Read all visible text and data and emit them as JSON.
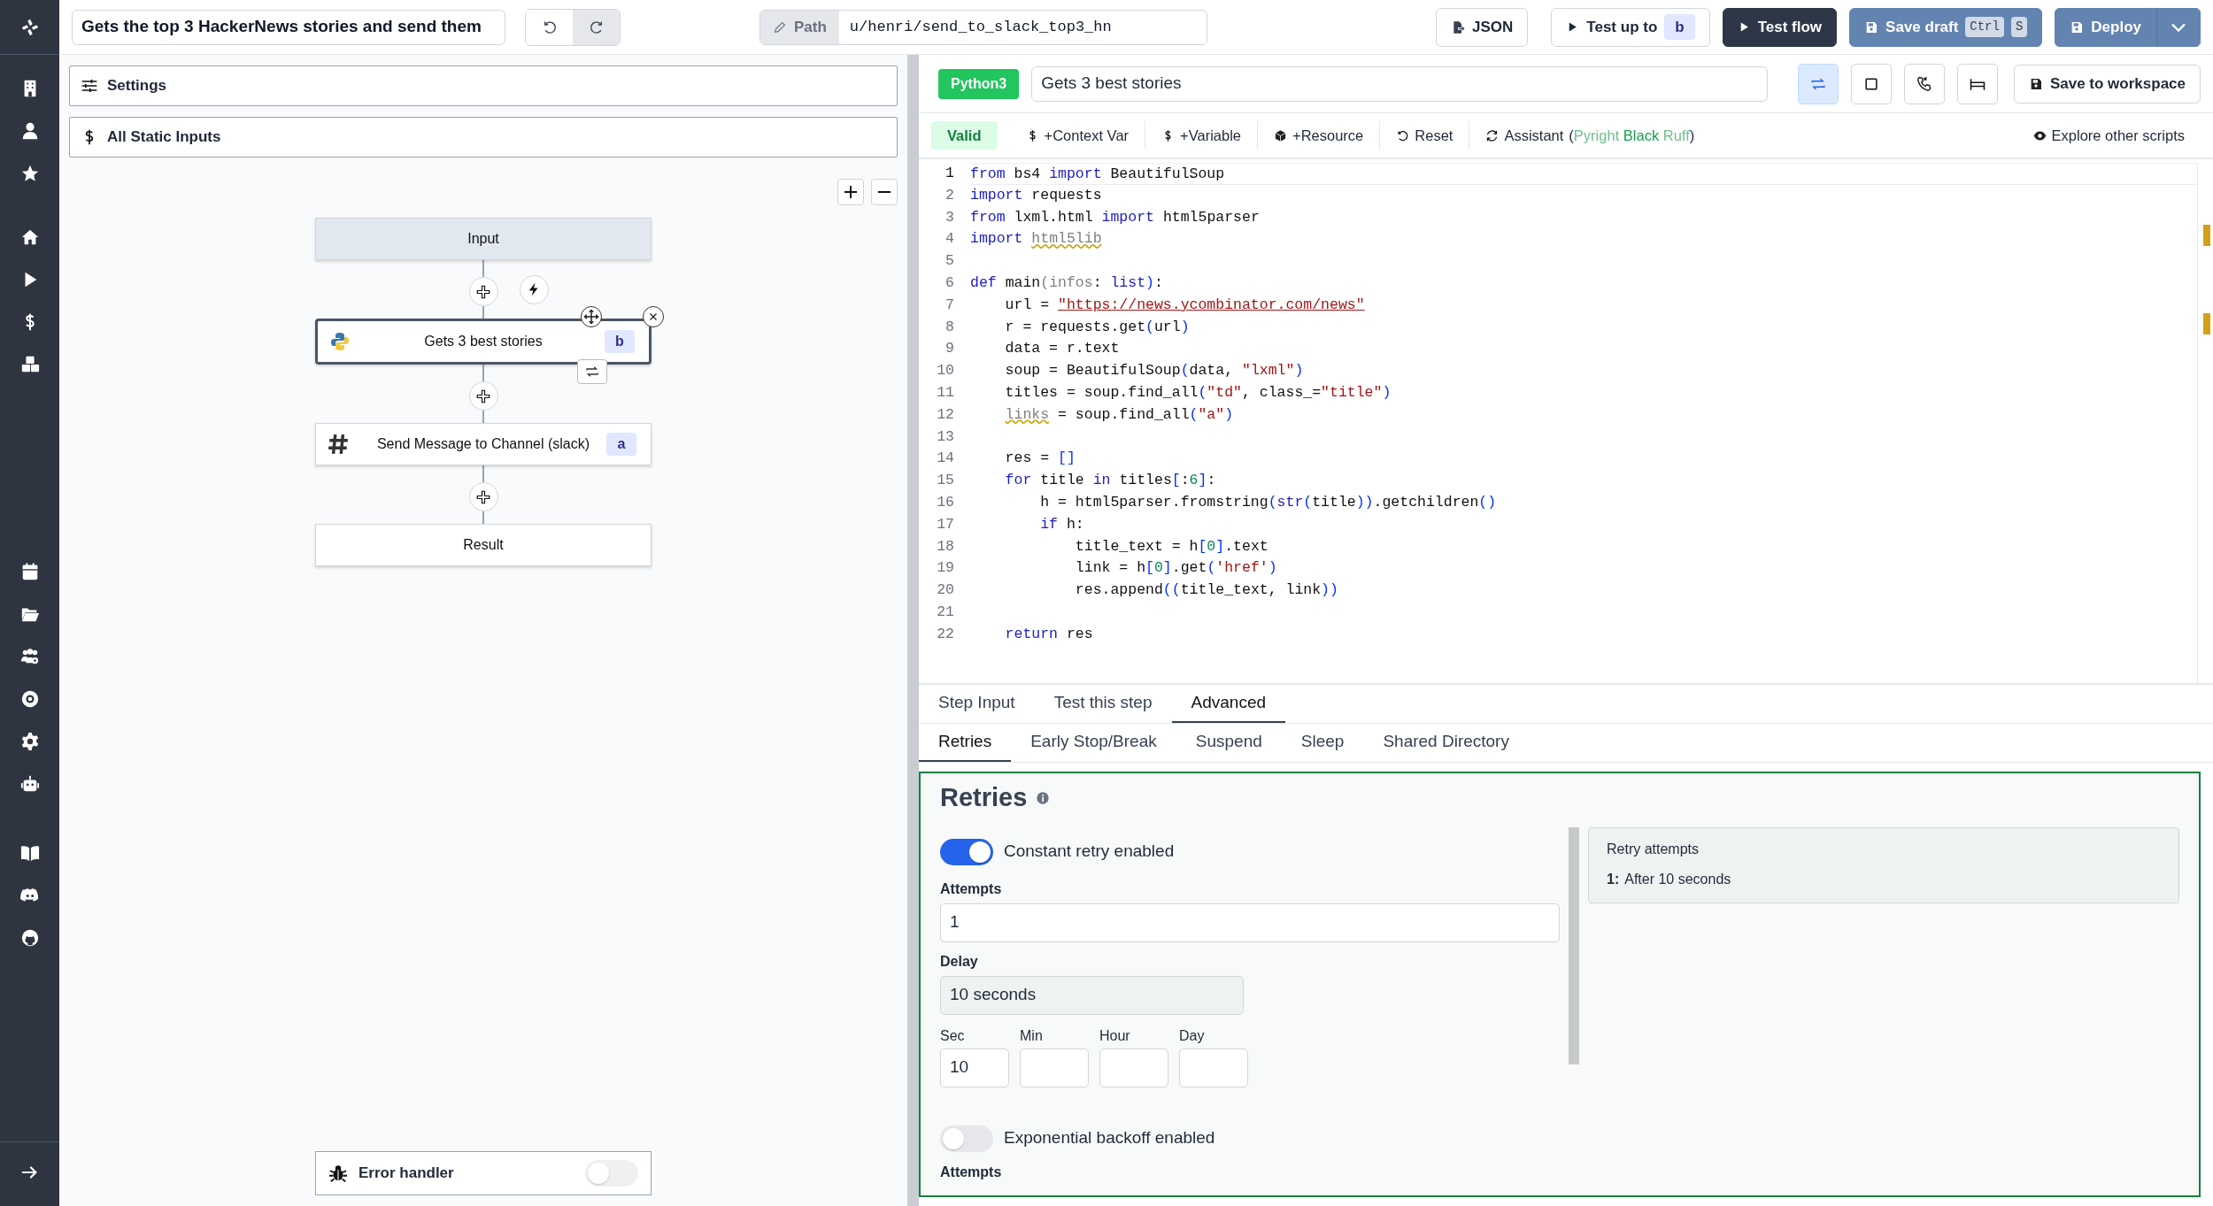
{
  "flow_title": "Gets the top 3 HackerNews stories and send them",
  "path": {
    "label": "Path",
    "value": "u/henri/send_to_slack_top3_hn"
  },
  "actions": [
    {
      "kind": "json",
      "label": "JSON"
    },
    {
      "kind": "test_up_to",
      "label": "Test up to",
      "badge": "b"
    },
    {
      "kind": "test_flow",
      "label": "Test flow"
    },
    {
      "kind": "save_draft",
      "label": "Save draft",
      "keys": [
        "Ctrl",
        "S"
      ]
    },
    {
      "kind": "deploy",
      "label": "Deploy"
    }
  ],
  "left_sections": [
    {
      "kind": "settings",
      "label": "Settings"
    },
    {
      "kind": "static",
      "label": "All Static Inputs"
    }
  ],
  "flow": {
    "nodes": [
      {
        "kind": "input",
        "label": "Input",
        "selected": false
      },
      {
        "kind": "script",
        "label": "Gets 3 best stories",
        "badge": "b",
        "selected": true
      },
      {
        "kind": "slack",
        "label": "Send Message to Channel (slack)",
        "badge": "a",
        "selected": false
      },
      {
        "kind": "result",
        "label": "Result",
        "selected": false
      }
    ]
  },
  "error_handler": {
    "label": "Error handler",
    "on": false
  },
  "script": {
    "language": "Python3",
    "summary": "Gets 3 best stories",
    "toggles": [
      {
        "kind": "loop",
        "on": true
      },
      {
        "kind": "square",
        "on": false
      },
      {
        "kind": "phone",
        "on": false
      },
      {
        "kind": "bed",
        "on": false
      }
    ],
    "save_label": "Save to workspace"
  },
  "editor_toolbar": [
    {
      "kind": "status",
      "label": "Valid"
    },
    {
      "kind": "context",
      "label": "+Context Var"
    },
    {
      "kind": "variable",
      "label": "+Variable"
    },
    {
      "kind": "resource",
      "label": "+Resource"
    },
    {
      "kind": "reset",
      "label": "Reset"
    },
    {
      "kind": "assistant",
      "label": "Assistant",
      "open": "(",
      "close": ")",
      "tools": [
        {
          "name": "Pyright",
          "active": false
        },
        {
          "name": "Black",
          "active": true
        },
        {
          "name": "Ruff",
          "active": false
        }
      ]
    }
  ],
  "explore_label": "Explore other scripts",
  "code": [
    {
      "number": "1",
      "tokens": [
        {
          "kind": "kw",
          "text": "from"
        },
        {
          "kind": "plain",
          "text": " bs4 "
        },
        {
          "kind": "kw",
          "text": "import"
        },
        {
          "kind": "plain",
          "text": " BeautifulSoup"
        }
      ]
    },
    {
      "number": "2",
      "tokens": [
        {
          "kind": "kw",
          "text": "import"
        },
        {
          "kind": "plain",
          "text": " requests"
        }
      ]
    },
    {
      "number": "3",
      "tokens": [
        {
          "kind": "kw",
          "text": "from"
        },
        {
          "kind": "plain",
          "text": " lxml.html "
        },
        {
          "kind": "kw",
          "text": "import"
        },
        {
          "kind": "plain",
          "text": " html5parser"
        }
      ]
    },
    {
      "number": "4",
      "tokens": [
        {
          "kind": "kw",
          "text": "import"
        },
        {
          "kind": "warn",
          "text": " html5lib"
        }
      ]
    },
    {
      "number": "5"
    },
    {
      "number": "6",
      "tokens": [
        {
          "kind": "kw",
          "text": "def"
        },
        {
          "kind": "plain",
          "text": " main"
        },
        {
          "kind": "param",
          "text": "(infos"
        },
        {
          "kind": "plain",
          "text": ": "
        },
        {
          "kind": "kw",
          "text": "list"
        },
        {
          "kind": "bracket",
          "text": ")"
        },
        {
          "kind": "plain",
          "text": ":"
        }
      ]
    },
    {
      "number": "7",
      "tokens": [
        {
          "kind": "plain",
          "text": "    url = "
        },
        {
          "kind": "link",
          "text": "\"https://news.ycombinator.com/news\""
        }
      ]
    },
    {
      "number": "8",
      "tokens": [
        {
          "kind": "plain",
          "text": "    r = requests.get"
        },
        {
          "kind": "bracket",
          "text": "("
        },
        {
          "kind": "plain",
          "text": "url"
        },
        {
          "kind": "bracket",
          "text": ")"
        }
      ]
    },
    {
      "number": "9",
      "tokens": [
        {
          "kind": "plain",
          "text": "    data = r.text"
        }
      ]
    },
    {
      "number": "10",
      "tokens": [
        {
          "kind": "plain",
          "text": "    soup = BeautifulSoup"
        },
        {
          "kind": "bracket",
          "text": "("
        },
        {
          "kind": "plain",
          "text": "data, "
        },
        {
          "kind": "str",
          "text": "\"lxml\""
        },
        {
          "kind": "bracket",
          "text": ")"
        }
      ]
    },
    {
      "number": "11",
      "tokens": [
        {
          "kind": "plain",
          "text": "    titles = soup.find_all"
        },
        {
          "kind": "bracket",
          "text": "("
        },
        {
          "kind": "str",
          "text": "\"td\""
        },
        {
          "kind": "plain",
          "text": ", class_="
        },
        {
          "kind": "str",
          "text": "\"title\""
        },
        {
          "kind": "bracket",
          "text": ")"
        }
      ]
    },
    {
      "number": "12",
      "tokens": [
        {
          "kind": "warn",
          "text": "    links"
        },
        {
          "kind": "plain",
          "text": " = soup.find_all"
        },
        {
          "kind": "bracket",
          "text": "("
        },
        {
          "kind": "str",
          "text": "\"a\""
        },
        {
          "kind": "bracket",
          "text": ")"
        }
      ]
    },
    {
      "number": "13"
    },
    {
      "number": "14",
      "tokens": [
        {
          "kind": "plain",
          "text": "    res = "
        },
        {
          "kind": "bracket",
          "text": "[]"
        }
      ]
    },
    {
      "number": "15",
      "tokens": [
        {
          "kind": "kw",
          "text": "    for"
        },
        {
          "kind": "plain",
          "text": " title "
        },
        {
          "kind": "kw",
          "text": "in"
        },
        {
          "kind": "plain",
          "text": " titles"
        },
        {
          "kind": "bracket",
          "text": "["
        },
        {
          "kind": "plain",
          "text": ":"
        },
        {
          "kind": "num",
          "text": "6"
        },
        {
          "kind": "bracket",
          "text": "]"
        },
        {
          "kind": "plain",
          "text": ":"
        }
      ]
    },
    {
      "number": "16",
      "tokens": [
        {
          "kind": "plain",
          "text": "        h = html5parser.fromstring"
        },
        {
          "kind": "bracket",
          "text": "("
        },
        {
          "kind": "kw",
          "text": "str"
        },
        {
          "kind": "bracket",
          "text": "("
        },
        {
          "kind": "plain",
          "text": "title"
        },
        {
          "kind": "bracket",
          "text": "))"
        },
        {
          "kind": "plain",
          "text": ".getchildren"
        },
        {
          "kind": "bracket",
          "text": "()"
        }
      ]
    },
    {
      "number": "17",
      "tokens": [
        {
          "kind": "kw",
          "text": "        if"
        },
        {
          "kind": "plain",
          "text": " h:"
        }
      ]
    },
    {
      "number": "18",
      "tokens": [
        {
          "kind": "plain",
          "text": "            title_text = h"
        },
        {
          "kind": "bracket",
          "text": "["
        },
        {
          "kind": "num",
          "text": "0"
        },
        {
          "kind": "bracket",
          "text": "]"
        },
        {
          "kind": "plain",
          "text": ".text"
        }
      ]
    },
    {
      "number": "19",
      "tokens": [
        {
          "kind": "plain",
          "text": "            link = h"
        },
        {
          "kind": "bracket",
          "text": "["
        },
        {
          "kind": "num",
          "text": "0"
        },
        {
          "kind": "bracket",
          "text": "]"
        },
        {
          "kind": "plain",
          "text": ".get"
        },
        {
          "kind": "bracket",
          "text": "("
        },
        {
          "kind": "str",
          "text": "'href'"
        },
        {
          "kind": "bracket",
          "text": ")"
        }
      ]
    },
    {
      "number": "20",
      "tokens": [
        {
          "kind": "plain",
          "text": "            res.append"
        },
        {
          "kind": "bracket",
          "text": "(("
        },
        {
          "kind": "plain",
          "text": "title_text, link"
        },
        {
          "kind": "bracket",
          "text": "))"
        }
      ]
    },
    {
      "number": "21"
    },
    {
      "number": "22",
      "tokens": [
        {
          "kind": "kw",
          "text": "    return"
        },
        {
          "kind": "plain",
          "text": " res"
        }
      ]
    }
  ],
  "tabs": [
    {
      "label": "Step Input",
      "selected": false
    },
    {
      "label": "Test this step",
      "selected": false
    },
    {
      "label": "Advanced",
      "selected": true
    }
  ],
  "subtabs": [
    {
      "label": "Retries",
      "selected": true
    },
    {
      "label": "Early Stop/Break",
      "selected": false
    },
    {
      "label": "Suspend",
      "selected": false
    },
    {
      "label": "Sleep",
      "selected": false
    },
    {
      "label": "Shared Directory",
      "selected": false
    }
  ],
  "retries": {
    "title": "Retries",
    "constant": {
      "label": "Constant retry enabled",
      "on": true
    },
    "attempts": {
      "label": "Attempts",
      "value": "1"
    },
    "delay": {
      "label": "Delay",
      "value": "10 seconds"
    },
    "units": [
      {
        "label": "Sec",
        "value": "10"
      },
      {
        "label": "Min"
      },
      {
        "label": "Hour"
      },
      {
        "label": "Day"
      }
    ],
    "exponential": {
      "label": "Exponential backoff enabled",
      "on": false
    },
    "next_label": "Attempts",
    "summary": {
      "title": "Retry attempts",
      "items": [
        {
          "index": "1:",
          "text": "After 10 seconds"
        }
      ]
    }
  }
}
